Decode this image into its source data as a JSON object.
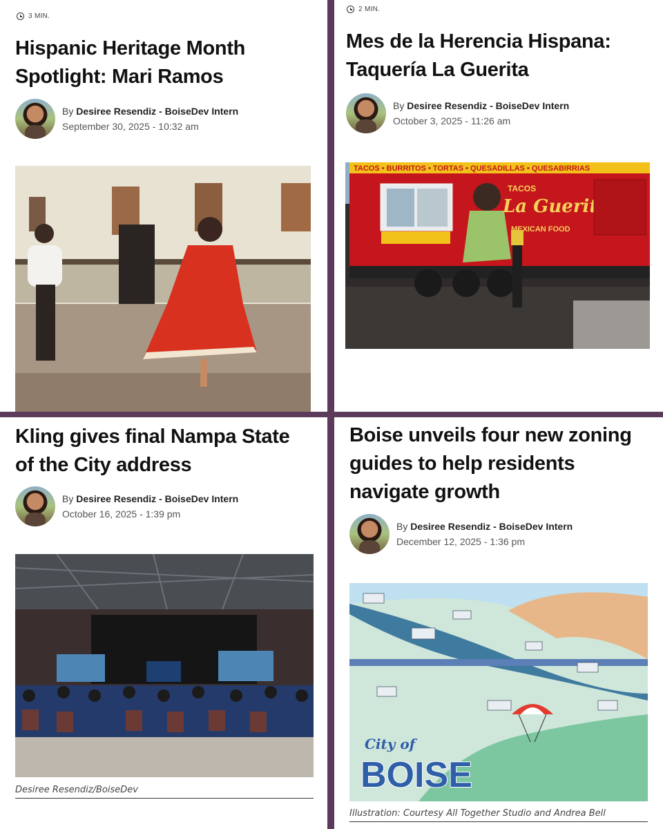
{
  "articles": [
    {
      "read_time": "3 MIN.",
      "title_lines": [
        "Hispanic Heritage Month",
        "Spotlight: Mari Ramos"
      ],
      "by": "By",
      "author": "Desiree Resendiz - BoiseDev Intern",
      "date": "September 30, 2025 - 10:32 am",
      "image": "vintage-dancers-photo"
    },
    {
      "read_time": "2 MIN.",
      "title_lines": [
        "Mes de la Herencia Hispana:",
        "Taquería La Guerita"
      ],
      "by": "By",
      "author": "Desiree Resendiz - BoiseDev Intern",
      "date": "October 3, 2025 - 11:26 am",
      "image": "food-truck-photo",
      "truck_banner": "TACOS • BURRITOS • TORTAS • QUESADILLAS • QUESABIRRIAS",
      "truck_brand": "La Guerita",
      "truck_tacos": "TACOS",
      "truck_sub": "MEXICAN FOOD"
    },
    {
      "title_lines": [
        "Kling gives final Nampa State",
        "of the City address"
      ],
      "by": "By",
      "author": "Desiree Resendiz - BoiseDev Intern",
      "date": "October 16, 2025 - 1:39 pm",
      "image": "arena-event-photo",
      "caption": "Desiree Resendiz/BoiseDev"
    },
    {
      "title_lines": [
        "Boise unveils four new zoning",
        "guides to help residents",
        "navigate growth"
      ],
      "by": "By",
      "author": "Desiree Resendiz - BoiseDev Intern",
      "date": "December 12, 2025 - 1:36 pm",
      "image": "boise-illustrated-map",
      "map_city_of": "City of",
      "map_boise": "BOISE",
      "caption": "Illustration: Courtesy All Together Studio and Andrea Bell"
    }
  ],
  "colors": {
    "divider": "#5b3a5c",
    "card_bg": "#ffffff",
    "truck_red": "#c4161c",
    "map_blue": "#2f5fa8"
  }
}
